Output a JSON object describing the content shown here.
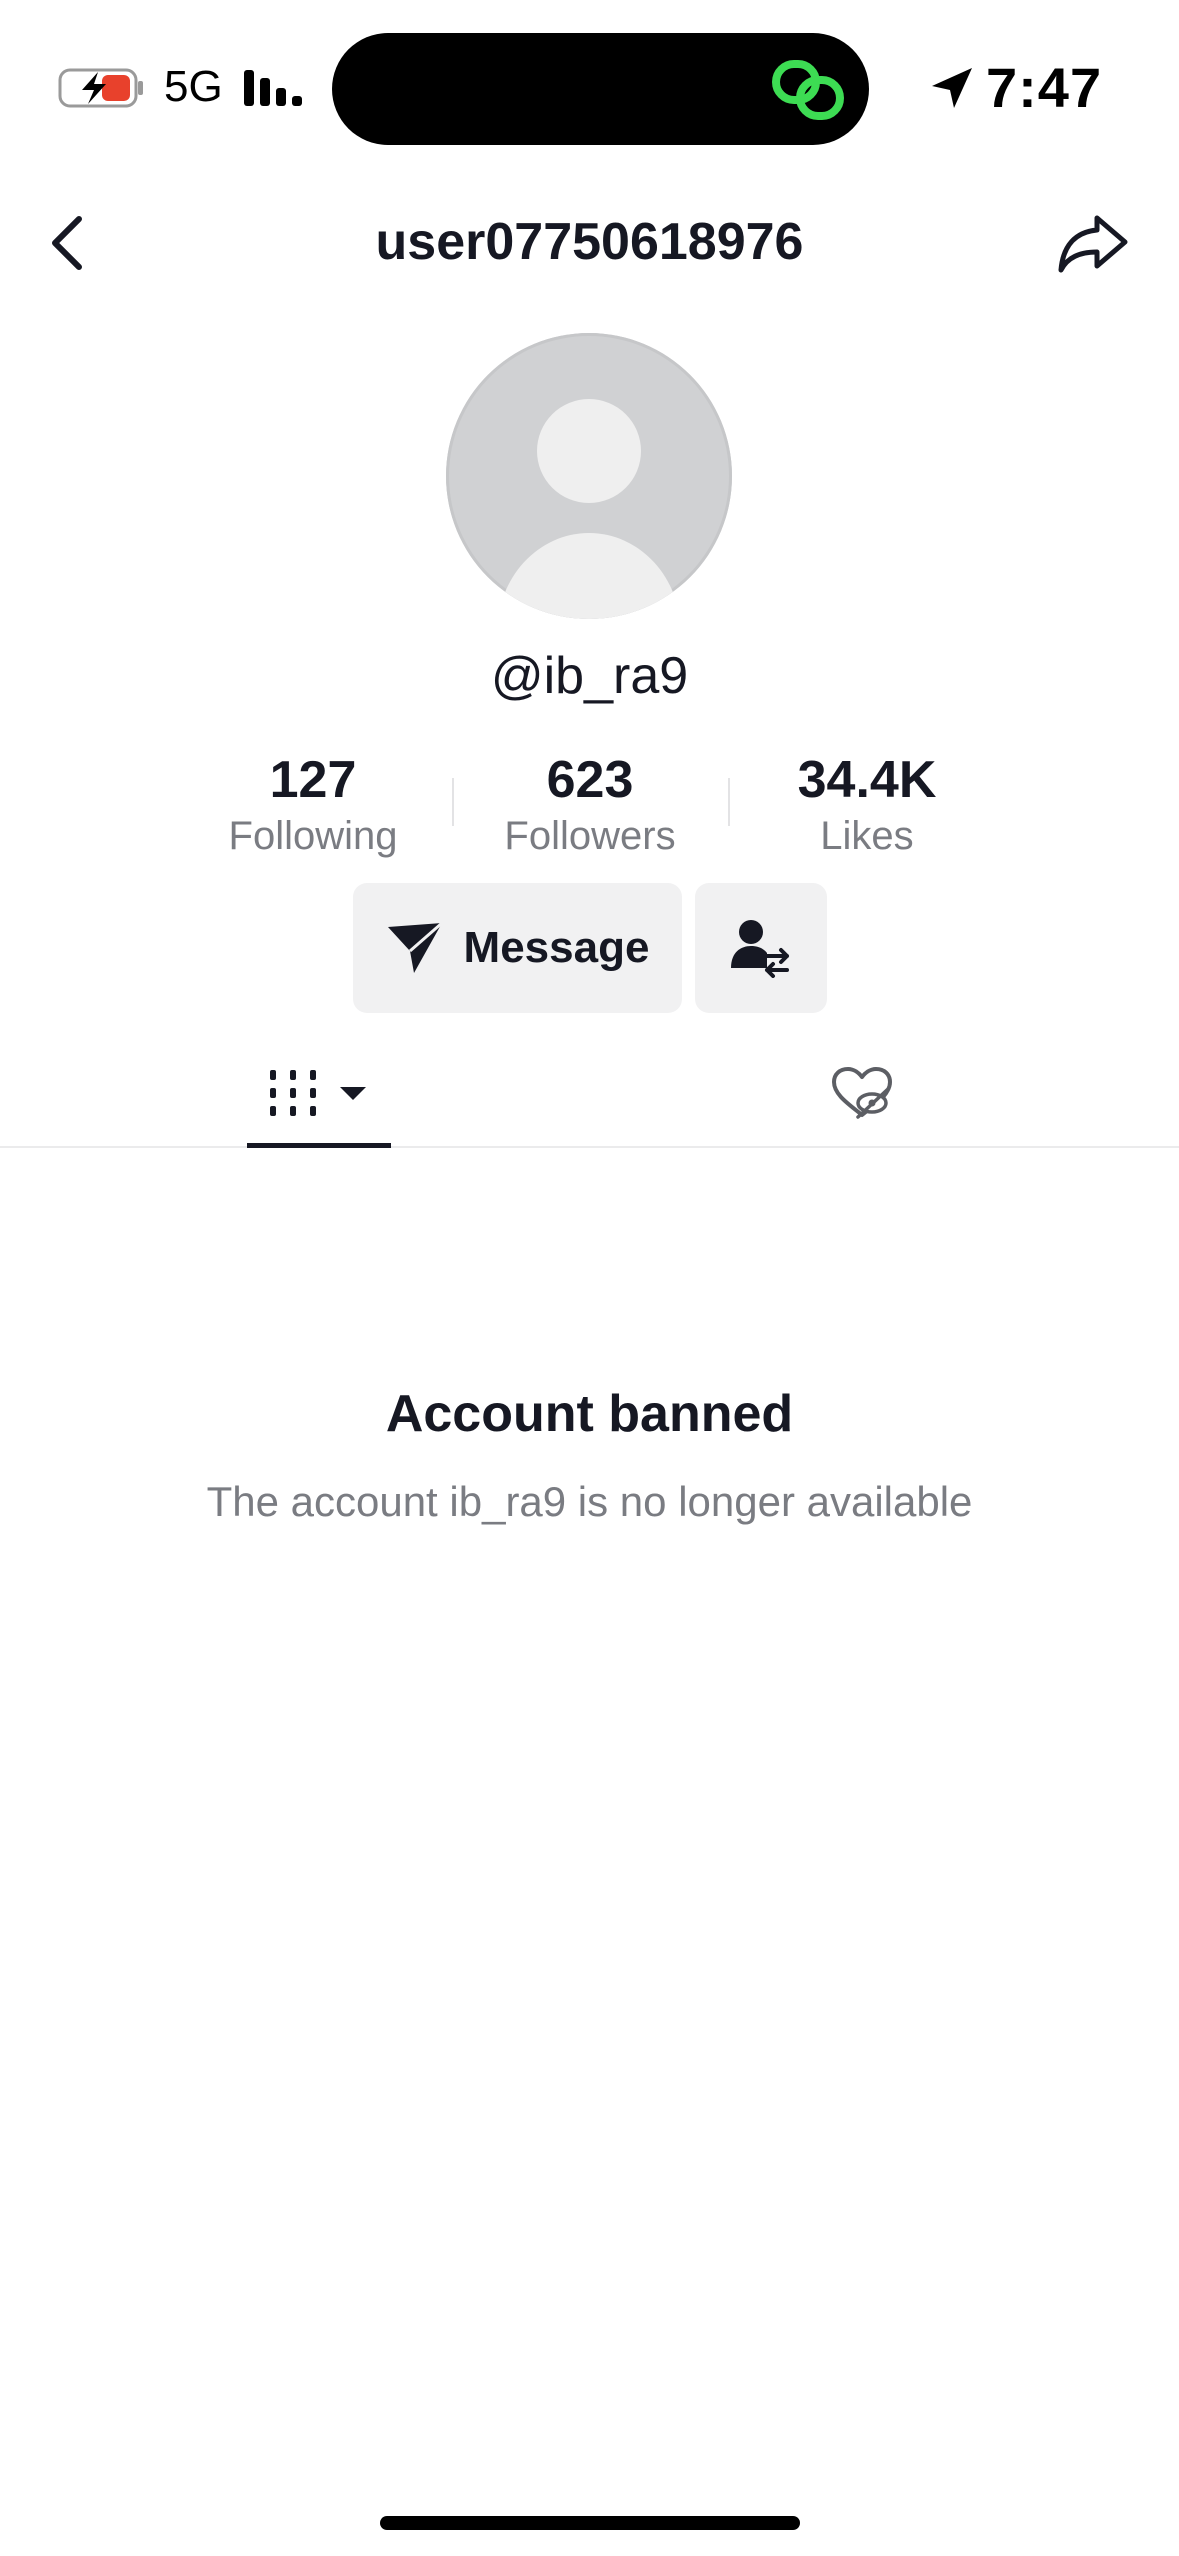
{
  "status_bar": {
    "network": "5G",
    "time": "7:47",
    "icons": [
      "battery-charging-icon",
      "signal-icon",
      "link-icon",
      "location-arrow-icon"
    ]
  },
  "nav": {
    "title": "user07750618976",
    "icons": [
      "chevron-left-icon",
      "share-icon"
    ]
  },
  "profile": {
    "handle": "@ib_ra9",
    "avatar": "default-avatar-icon",
    "stats": [
      {
        "value": "127",
        "label": "Following"
      },
      {
        "value": "623",
        "label": "Followers"
      },
      {
        "value": "34.4K",
        "label": "Likes"
      }
    ]
  },
  "actions": {
    "message_label": "Message",
    "icons": [
      "send-icon",
      "add-friend-icon"
    ]
  },
  "tabs": {
    "icons": [
      "grid-icon",
      "dropdown-caret-icon",
      "liked-hidden-icon"
    ],
    "active": "videos"
  },
  "empty_state": {
    "title": "Account banned",
    "description": "The account ib_ra9 is no longer available"
  },
  "colors": {
    "text_primary": "#161823",
    "text_secondary": "#7a7c82",
    "button_bg": "#f1f1f2",
    "battery_low": "#e8412c",
    "link_green": "#3ddc53",
    "avatar_bg": "#d0d1d3"
  }
}
